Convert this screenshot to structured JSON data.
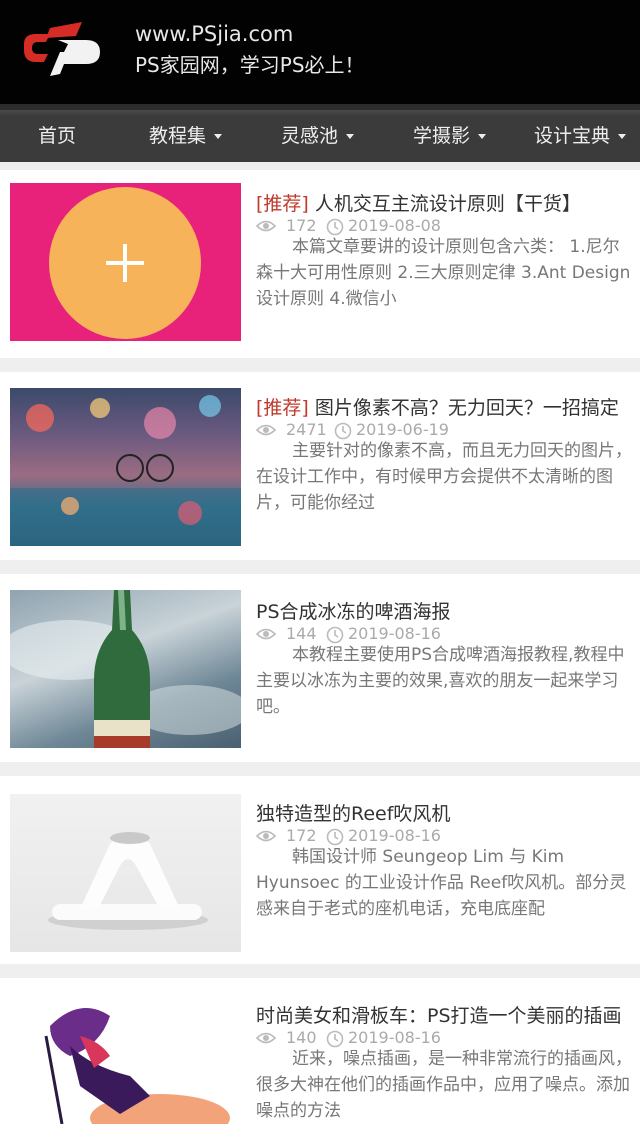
{
  "site": {
    "url": "www.PSjia.com",
    "slogan": "PS家园网，学习PS必上！"
  },
  "nav": [
    {
      "label": "首页",
      "dropdown": false
    },
    {
      "label": "教程集",
      "dropdown": true
    },
    {
      "label": "灵感池",
      "dropdown": true
    },
    {
      "label": "学摄影",
      "dropdown": true
    },
    {
      "label": "设计宝典",
      "dropdown": true
    }
  ],
  "articles": [
    {
      "tag": "[推荐]",
      "title": "人机交互主流设计原则【干货】",
      "views": "172",
      "date": "2019-08-08",
      "summary": "本篇文章要讲的设计原则包含六类： 1.尼尔森十大可用性原则 2.三大原则定律 3.Ant Design设计原则 4.微信小"
    },
    {
      "tag": "[推荐]",
      "title": "图片像素不高？无力回天？一招搞定",
      "views": "2471",
      "date": "2019-06-19",
      "summary": "主要针对的像素不高，而且无力回天的图片，在设计工作中，有时候甲方会提供不太清晰的图片，可能你经过"
    },
    {
      "tag": "",
      "title": "PS合成冰冻的啤酒海报",
      "views": "144",
      "date": "2019-08-16",
      "summary": "本教程主要使用PS合成啤酒海报教程,教程中主要以冰冻为主要的效果,喜欢的朋友一起来学习吧。"
    },
    {
      "tag": "",
      "title": "独特造型的Reef吹风机",
      "views": "172",
      "date": "2019-08-16",
      "summary": "韩国设计师 Seungeop Lim 与 Kim Hyunsoec 的工业设计作品 Reef吹风机。部分灵感来自于老式的座机电话，充电底座配"
    },
    {
      "tag": "",
      "title": "时尚美女和滑板车：PS打造一个美丽的插画",
      "views": "140",
      "date": "2019-08-16",
      "summary": "近来，噪点插画，是一种非常流行的插画风，很多大神在他们的插画作品中，应用了噪点。添加噪点的方法"
    }
  ],
  "colors": {
    "header_bg": "#020202",
    "nav_bg": "#3b3b3b",
    "tag": "#c0392b",
    "placeholder_bg": "#e8227a",
    "placeholder_circle": "#f6b35a"
  }
}
